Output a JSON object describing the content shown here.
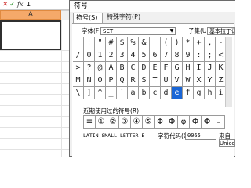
{
  "spreadsheet": {
    "formula_bar": {
      "cancel_glyph": "✕",
      "enter_glyph": "✓",
      "fx_glyph": "fx",
      "value": "1"
    },
    "column_header": "A"
  },
  "dialog": {
    "title": "符号",
    "tabs": [
      {
        "label": "符号(S)"
      },
      {
        "label": "特殊字符(P)"
      }
    ],
    "font_label": "字体(F):",
    "font_value": "SET",
    "subset_label": "子集(U):",
    "subset_value": "基本拉丁语",
    "grid_rows": [
      [
        "",
        "!",
        "\"",
        "#",
        "$",
        "%",
        "&",
        "'",
        "(",
        ")",
        "*",
        "+",
        ",",
        "-"
      ],
      [
        "/",
        "0",
        "1",
        "2",
        "3",
        "4",
        "5",
        "6",
        "7",
        "8",
        "9",
        ":",
        ";",
        "<"
      ],
      [
        ">",
        "?",
        "@",
        "A",
        "B",
        "C",
        "D",
        "E",
        "F",
        "G",
        "H",
        "I",
        "J",
        "K"
      ],
      [
        "M",
        "N",
        "O",
        "P",
        "Q",
        "R",
        "S",
        "T",
        "U",
        "V",
        "W",
        "X",
        "Y",
        "Z"
      ],
      [
        "\\",
        "]",
        "^",
        "_",
        "`",
        "a",
        "b",
        "c",
        "d",
        "e",
        "f",
        "g",
        "h",
        "i"
      ]
    ],
    "selected_index": [
      4,
      9
    ],
    "recent_label": "近期使用过的符号(R):",
    "recent_symbols": [
      "≡",
      "①",
      "②",
      "③",
      "④",
      "⑤",
      "Φ",
      "Ф",
      "φ",
      "Ф",
      "Ф",
      "₋"
    ],
    "char_name": "LATIN SMALL LETTER E",
    "code_label": "字符代码(C):",
    "code_value": "0065",
    "from_label": "来自(M):",
    "from_value": "Unicode"
  }
}
